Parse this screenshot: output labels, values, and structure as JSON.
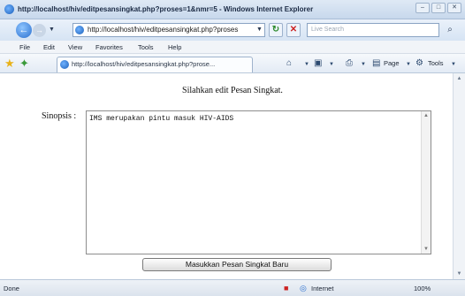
{
  "window": {
    "title": "http://localhost/hiv/editpesansingkat.php?proses=1&nmr=5 - Windows Internet Explorer",
    "controls": [
      "–",
      "□",
      "✕"
    ]
  },
  "address_bar": {
    "url": "http://localhost/hiv/editpesansingkat.php?proses",
    "search_placeholder": "Live Search"
  },
  "menu": [
    "File",
    "Edit",
    "View",
    "Favorites",
    "Tools",
    "Help"
  ],
  "toolbar": {
    "tab_label": "http://localhost/hiv/editpesansingkat.php?prose...",
    "page_label": "Page",
    "tools_label": "Tools"
  },
  "content": {
    "heading": "Silahkan edit Pesan Singkat.",
    "field_label": "Sinopsis :",
    "textarea_value": "IMS merupakan pintu masuk HIV-AIDS",
    "submit_label": "Masukkan Pesan Singkat Baru"
  },
  "status": {
    "text": "Done",
    "zone": "Internet",
    "zoom": "100%"
  },
  "icons": {
    "back": "back-arrow-icon",
    "forward": "forward-arrow-icon",
    "refresh": "refresh-icon",
    "stop": "stop-icon",
    "search": "search-icon",
    "favorites": "star-icon",
    "add_favorites": "add-favorite-icon",
    "home": "home-icon",
    "feeds": "feeds-icon",
    "print": "print-icon",
    "globe": "globe-icon"
  }
}
